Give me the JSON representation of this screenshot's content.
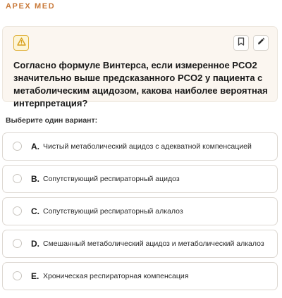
{
  "header": {
    "brand": "APEX MED"
  },
  "question": {
    "text": "Согласно формуле Винтерса, если измеренное PCO2 значительно выше предсказанного PCO2 у пациента с метаболическим ацидозом, какова наиболее вероятная интерпретация?",
    "badge_icon": "warning-triangle-icon",
    "actions": [
      "bookmark-icon",
      "pencil-icon"
    ]
  },
  "instruction": "Выберите один вариант:",
  "options": [
    {
      "letter": "A.",
      "text": "Чистый метаболический ацидоз с адекватной компенсацией"
    },
    {
      "letter": "B.",
      "text": "Сопутствующий респираторный ацидоз"
    },
    {
      "letter": "C.",
      "text": "Сопутствующий респираторный алкалоз"
    },
    {
      "letter": "D.",
      "text": "Смешанный метаболический ацидоз и метаболический алкалоз"
    },
    {
      "letter": "E.",
      "text": "Хроническая респираторная компенсация"
    }
  ],
  "colors": {
    "brand": "#c97a3a",
    "card_bg": "#fbf6f0",
    "warning": "#e0b23c"
  }
}
